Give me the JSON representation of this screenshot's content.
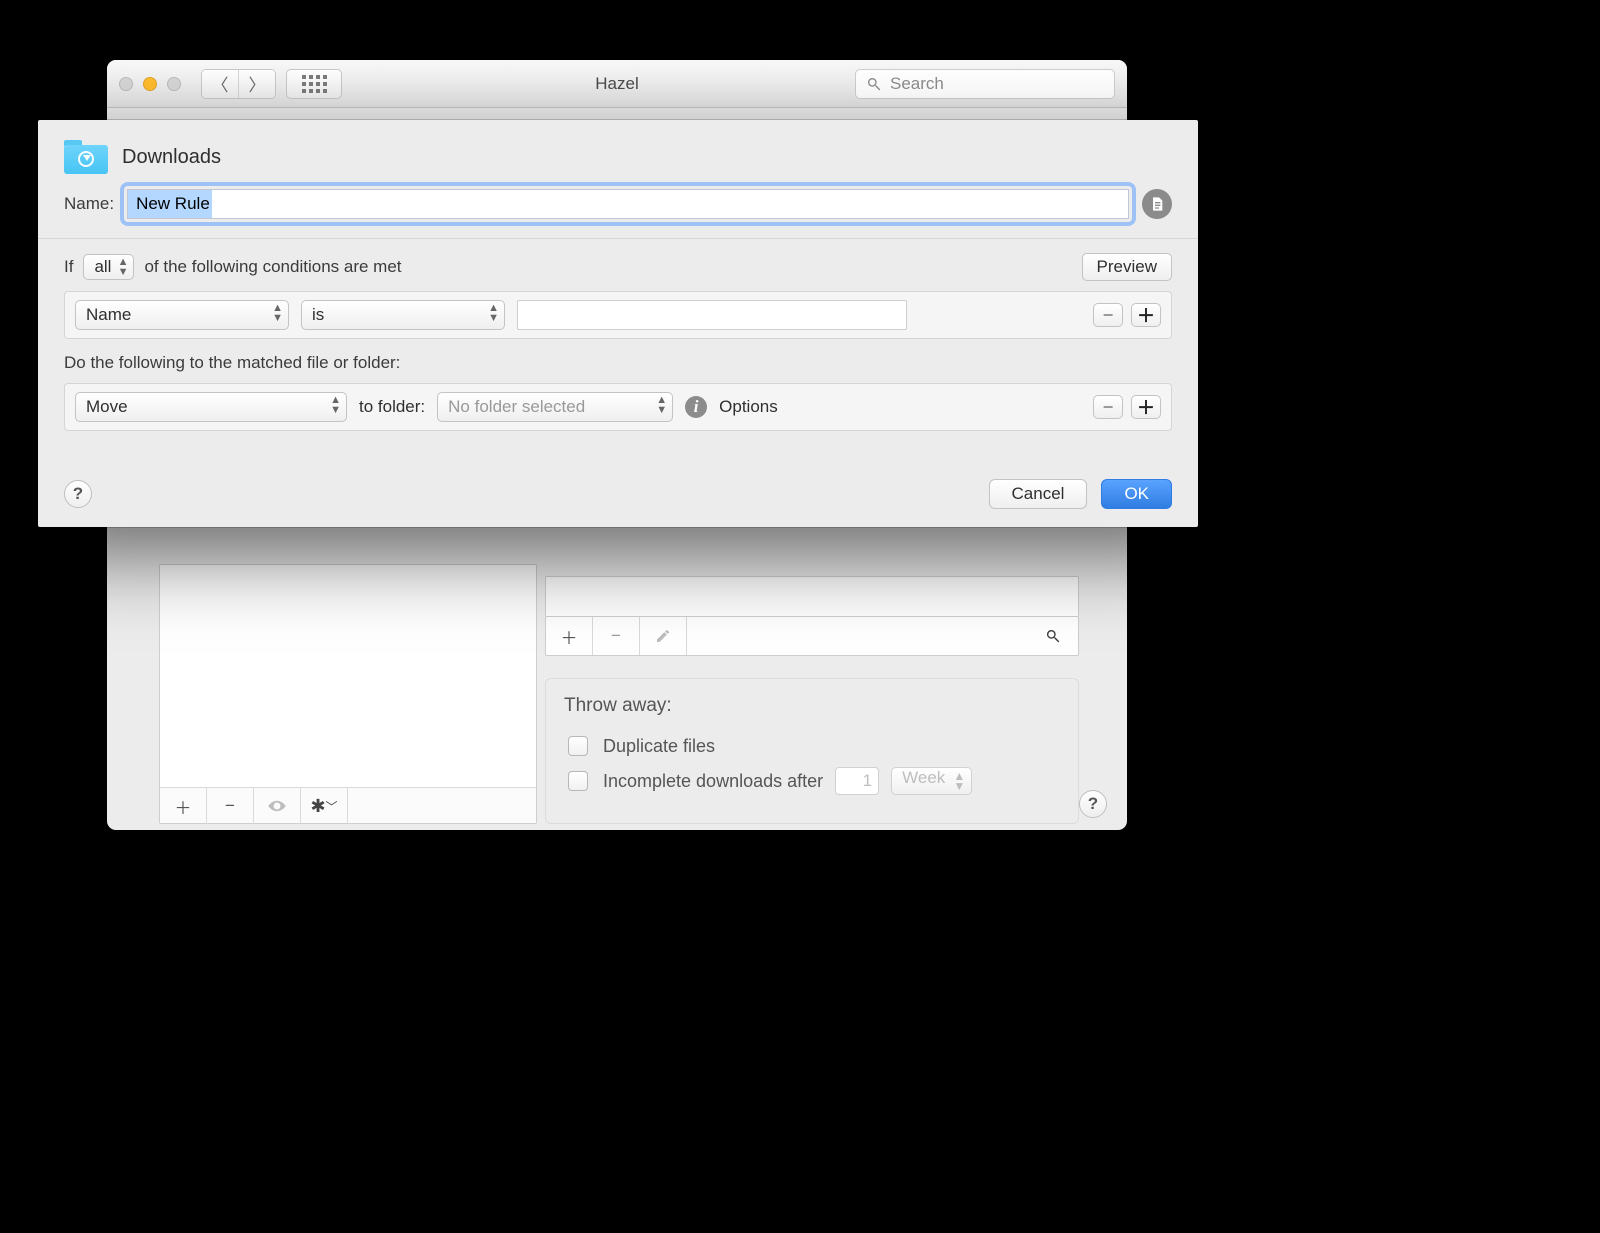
{
  "parent_window": {
    "title": "Hazel",
    "search_placeholder": "Search"
  },
  "sheet": {
    "folder_name": "Downloads",
    "name_label": "Name:",
    "name_value": "New Rule",
    "condition_sentence": {
      "if": "If",
      "quantifier": "all",
      "rest": "of the following conditions are met"
    },
    "preview_label": "Preview",
    "condition": {
      "attribute": "Name",
      "operator": "is",
      "value": ""
    },
    "actions_header": "Do the following to the matched file or folder:",
    "action": {
      "verb": "Move",
      "to_folder_label": "to folder:",
      "folder": "No folder selected",
      "options_label": "Options"
    },
    "cancel": "Cancel",
    "ok": "OK"
  },
  "throw_away": {
    "title": "Throw away:",
    "duplicate": "Duplicate files",
    "incomplete": "Incomplete downloads after",
    "incomplete_value": "1",
    "incomplete_unit": "Week"
  }
}
